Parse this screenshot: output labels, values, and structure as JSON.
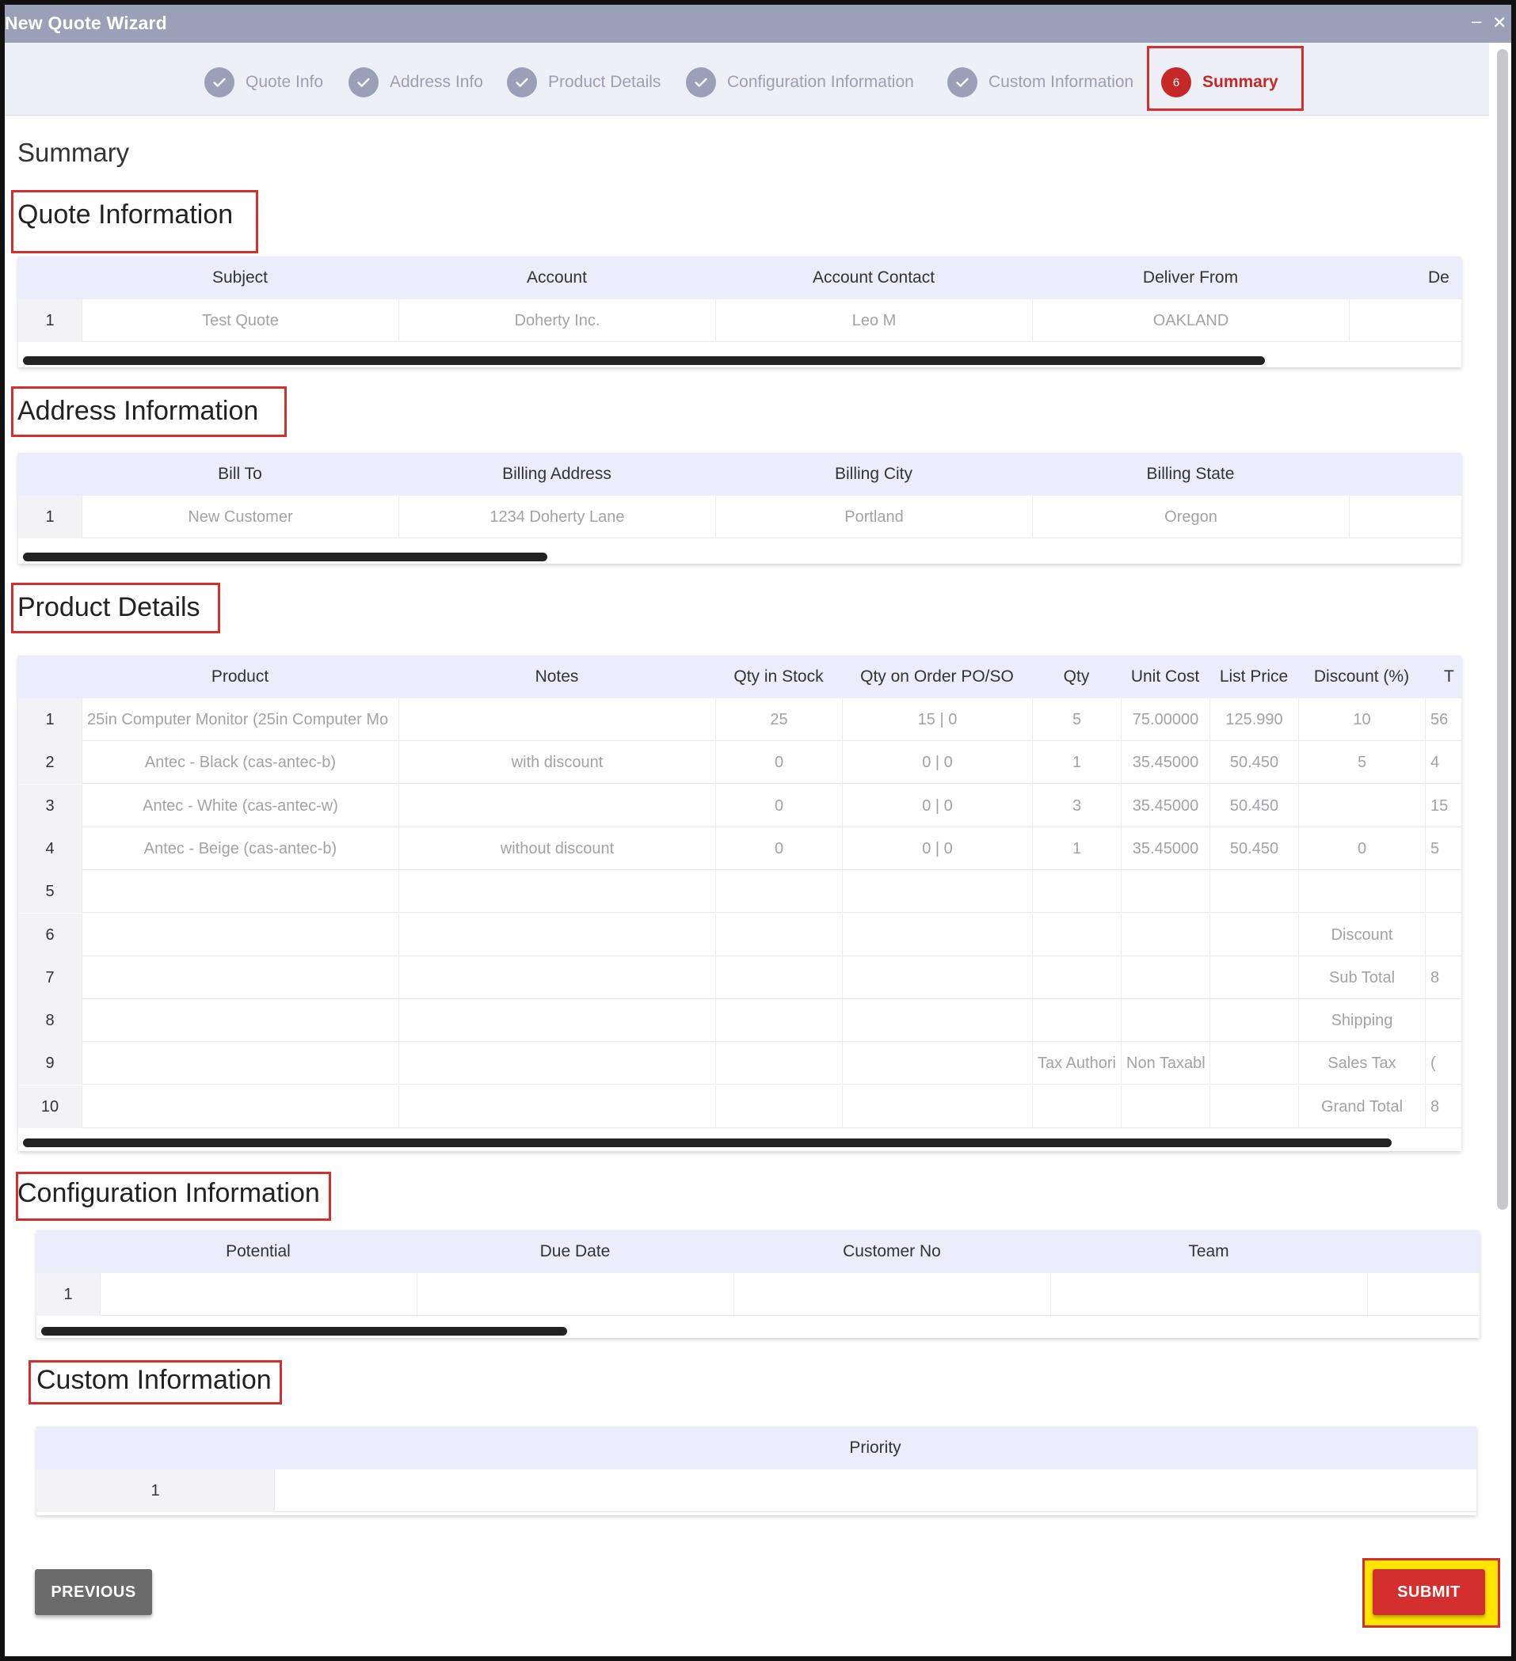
{
  "window": {
    "title": "New Quote Wizard",
    "minimize_glyph": "‒",
    "close_glyph": "✕"
  },
  "stepper": {
    "steps": [
      {
        "label": "Quote Info",
        "state": "done",
        "icon": "check-icon"
      },
      {
        "label": "Address Info",
        "state": "done",
        "icon": "check-icon"
      },
      {
        "label": "Product Details",
        "state": "done",
        "icon": "check-icon"
      },
      {
        "label": "Configuration Information",
        "state": "done",
        "icon": "check-icon"
      },
      {
        "label": "Custom Information",
        "state": "done",
        "icon": "check-icon"
      },
      {
        "label": "Summary",
        "state": "active",
        "number": "6"
      }
    ]
  },
  "page": {
    "title": "Summary"
  },
  "quote_info": {
    "title": "Quote Information",
    "columns": [
      "Subject",
      "Account",
      "Account Contact",
      "Deliver From",
      "De"
    ],
    "rows": [
      {
        "num": "1",
        "cells": [
          "Test Quote",
          "Doherty Inc.",
          "Leo M",
          "OAKLAND",
          ""
        ]
      }
    ]
  },
  "address_info": {
    "title": "Address Information",
    "columns": [
      "Bill To",
      "Billing Address",
      "Billing City",
      "Billing State",
      ""
    ],
    "rows": [
      {
        "num": "1",
        "cells": [
          "New Customer",
          "1234 Doherty Lane",
          "Portland",
          "Oregon",
          ""
        ]
      }
    ]
  },
  "product_details": {
    "title": "Product Details",
    "columns": [
      "Product",
      "Notes",
      "Qty in Stock",
      "Qty on Order PO/SO",
      "Qty",
      "Unit Cost",
      "List Price",
      "Discount (%)",
      "T"
    ],
    "rows": [
      {
        "num": "1",
        "cells": [
          "25in Computer Monitor (25in Computer Mo",
          "",
          "25",
          "15 | 0",
          "5",
          "75.00000",
          "125.990",
          "10",
          "56"
        ]
      },
      {
        "num": "2",
        "cells": [
          "Antec - Black (cas-antec-b)",
          "with discount",
          "0",
          "0 | 0",
          "1",
          "35.45000",
          "50.450",
          "5",
          "4"
        ]
      },
      {
        "num": "3",
        "cells": [
          "Antec - White (cas-antec-w)",
          "",
          "0",
          "0 | 0",
          "3",
          "35.45000",
          "50.450",
          "",
          "15"
        ]
      },
      {
        "num": "4",
        "cells": [
          "Antec - Beige (cas-antec-b)",
          "without discount",
          "0",
          "0 | 0",
          "1",
          "35.45000",
          "50.450",
          "0",
          "5"
        ]
      },
      {
        "num": "5",
        "cells": [
          "",
          "",
          "",
          "",
          "",
          "",
          "",
          "",
          ""
        ]
      },
      {
        "num": "6",
        "cells": [
          "",
          "",
          "",
          "",
          "",
          "",
          "",
          "Discount",
          ""
        ]
      },
      {
        "num": "7",
        "cells": [
          "",
          "",
          "",
          "",
          "",
          "",
          "",
          "Sub Total",
          "8"
        ]
      },
      {
        "num": "8",
        "cells": [
          "",
          "",
          "",
          "",
          "",
          "",
          "",
          "Shipping",
          ""
        ]
      },
      {
        "num": "9",
        "cells": [
          "",
          "",
          "",
          "",
          "Tax Authori",
          "Non Taxabl",
          "",
          "Sales Tax",
          "("
        ]
      },
      {
        "num": "10",
        "cells": [
          "",
          "",
          "",
          "",
          "",
          "",
          "",
          "Grand Total",
          "8"
        ]
      }
    ]
  },
  "config_info": {
    "title": "Configuration Information",
    "columns": [
      "Potential",
      "Due Date",
      "Customer No",
      "Team",
      ""
    ],
    "rows": [
      {
        "num": "1",
        "cells": [
          "",
          "",
          "",
          "",
          ""
        ]
      }
    ]
  },
  "custom_info": {
    "title": "Custom Information",
    "columns": [
      "Priority"
    ],
    "rows": [
      {
        "num": "1",
        "cells": [
          ""
        ]
      }
    ]
  },
  "buttons": {
    "previous": "PREVIOUS",
    "submit": "SUBMIT"
  },
  "colors": {
    "accent": "#d32f2f",
    "titlebar": "#9aa0b8",
    "stepper_bg": "#eef0f8",
    "grid_header": "#ebeefa",
    "highlight": "#ffe600"
  }
}
